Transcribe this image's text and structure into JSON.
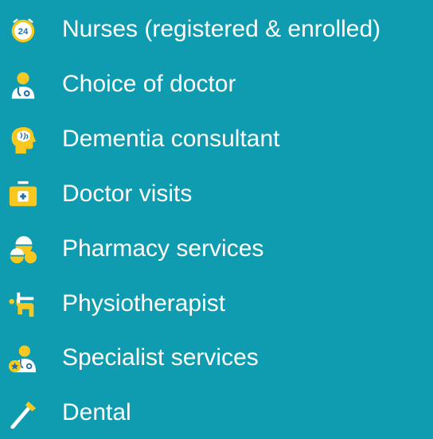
{
  "colors": {
    "background": "#0f9cb0",
    "icon_yellow": "#f7c81f",
    "icon_white": "#ffffff",
    "icon_blue": "#1f6fa8",
    "text": "#ffffff"
  },
  "services": [
    {
      "label": "Nurses (registered & enrolled)",
      "icon": "clock-24-icon",
      "icon_text": "24"
    },
    {
      "label": "Choice of doctor",
      "icon": "doctor-icon"
    },
    {
      "label": "Dementia consultant",
      "icon": "brain-head-icon"
    },
    {
      "label": "Doctor visits",
      "icon": "medical-kit-icon"
    },
    {
      "label": "Pharmacy services",
      "icon": "pills-icon"
    },
    {
      "label": "Physiotherapist",
      "icon": "physiotherapy-icon"
    },
    {
      "label": "Specialist services",
      "icon": "specialist-icon"
    },
    {
      "label": "Dental",
      "icon": "toothbrush-icon"
    }
  ]
}
